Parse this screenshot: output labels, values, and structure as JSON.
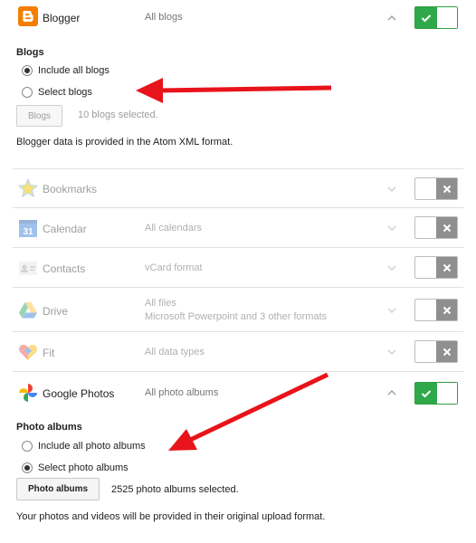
{
  "blogger": {
    "name": "Blogger",
    "desc": "All blogs",
    "section_title": "Blogs",
    "radio_all": "Include all blogs",
    "radio_select": "Select blogs",
    "button": "Blogs",
    "selected_text": "10 blogs selected.",
    "format_note": "Blogger data is provided in the Atom XML format."
  },
  "products": [
    {
      "name": "Bookmarks",
      "desc": ""
    },
    {
      "name": "Calendar",
      "desc": "All calendars"
    },
    {
      "name": "Contacts",
      "desc": "vCard format"
    },
    {
      "name": "Drive",
      "desc": "All files",
      "desc2": "Microsoft Powerpoint and 3 other formats"
    },
    {
      "name": "Fit",
      "desc": "All data types"
    }
  ],
  "photos": {
    "name": "Google Photos",
    "desc": "All photo albums",
    "section_title": "Photo albums",
    "radio_all": "Include all photo albums",
    "radio_select": "Select photo albums",
    "button": "Photo albums",
    "selected_text": "2525 photo albums selected.",
    "format_note": "Your photos and videos will be provided in their original upload format."
  },
  "colors": {
    "toggle_on": "#2fa84a",
    "toggle_off": "#8f8f8f",
    "arrow": "#e8141b",
    "blogger_orange": "#f57d00"
  },
  "icons": [
    "blogger-icon",
    "bookmarks-star-icon",
    "calendar-icon",
    "contacts-icon",
    "drive-icon",
    "fit-heart-icon",
    "google-photos-icon",
    "checkmark-icon",
    "x-icon",
    "chevron-up-icon",
    "chevron-down-icon",
    "red-arrow"
  ]
}
